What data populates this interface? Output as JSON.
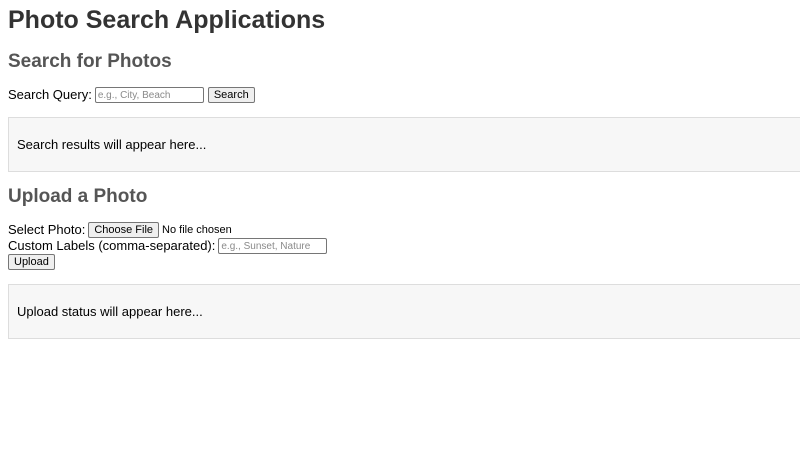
{
  "page": {
    "title": "Photo Search Applications"
  },
  "search": {
    "heading": "Search for Photos",
    "query_label": "Search Query:",
    "query_placeholder": "e.g., City, Beach",
    "query_value": "",
    "button_label": "Search",
    "results_text": "Search results will appear here..."
  },
  "upload": {
    "heading": "Upload a Photo",
    "select_label": "Select Photo:",
    "choose_file_label": "Choose File",
    "file_status": "No file chosen",
    "labels_label": "Custom Labels (comma-separated):",
    "labels_placeholder": "e.g., Sunset, Nature",
    "labels_value": "",
    "button_label": "Upload",
    "status_text": "Upload status will appear here..."
  }
}
